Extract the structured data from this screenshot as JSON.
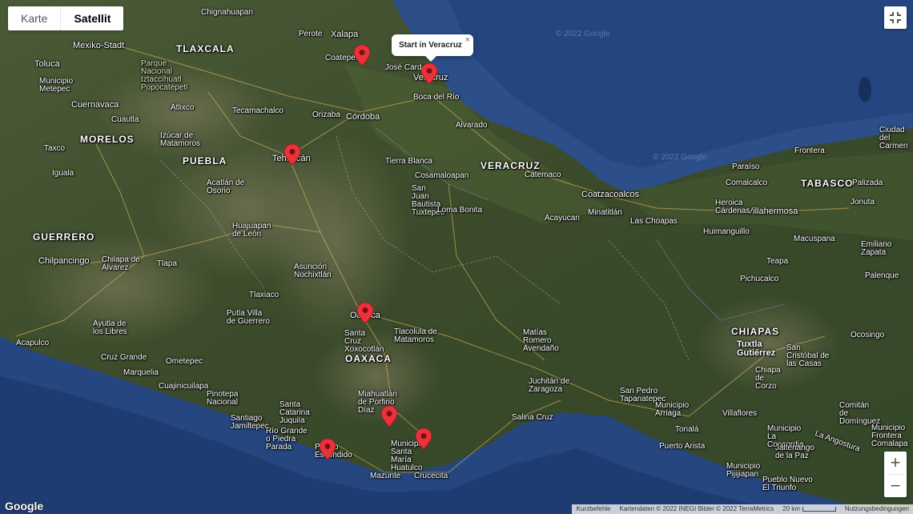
{
  "map_type": {
    "map_label": "Karte",
    "satellite_label": "Satellit",
    "active": "Satellit"
  },
  "info_window": {
    "title": "Start in Veracruz",
    "close_glyph": "×"
  },
  "controls": {
    "zoom_in": "+",
    "zoom_out": "−"
  },
  "logo": "Google",
  "footer": {
    "shortcuts": "Kurzbefehle",
    "map_data": "Kartendaten © 2022 INEGI Bilder © 2022 TerraMetrics",
    "scale": "20 km",
    "terms": "Nutzungsbedingungen"
  },
  "water_watermarks": [
    "© 2022 Google",
    "© 2022 Google"
  ],
  "regions": [
    {
      "name": "TLAXCALA"
    },
    {
      "name": "PUEBLA"
    },
    {
      "name": "MORELOS"
    },
    {
      "name": "GUERRERO"
    },
    {
      "name": "VERACRUZ"
    },
    {
      "name": "TABASCO"
    },
    {
      "name": "OAXACA"
    },
    {
      "name": "CHIAPAS"
    }
  ],
  "cities": [
    {
      "name": "Mexiko-Stadt"
    },
    {
      "name": "Toluca"
    },
    {
      "name": "Xalapa"
    },
    {
      "name": "Coatepec"
    },
    {
      "name": "José Cardel"
    },
    {
      "name": "Veracruz"
    },
    {
      "name": "Boca del Río"
    },
    {
      "name": "Córdoba"
    },
    {
      "name": "Orizaba"
    },
    {
      "name": "Alvarado"
    },
    {
      "name": "Tehuacán"
    },
    {
      "name": "Cuernavaca"
    },
    {
      "name": "Cuautla"
    },
    {
      "name": "Taxco"
    },
    {
      "name": "Iguala"
    },
    {
      "name": "Atlixco"
    },
    {
      "name": "Tecamachalco"
    },
    {
      "name": "Izúcar de Matamoros"
    },
    {
      "name": "Acatlán de Osorio"
    },
    {
      "name": "Huajuapan de León"
    },
    {
      "name": "Asunción Nochixtlán"
    },
    {
      "name": "Tlaxiaco"
    },
    {
      "name": "Chilpancingo"
    },
    {
      "name": "Chilapa de Álvarez"
    },
    {
      "name": "Tlapa"
    },
    {
      "name": "Tierra Blanca"
    },
    {
      "name": "Cosamaloapan"
    },
    {
      "name": "San Juan Bautista Tuxtepec"
    },
    {
      "name": "Loma Bonita"
    },
    {
      "name": "Catemaco"
    },
    {
      "name": "Coatzacoalcos"
    },
    {
      "name": "Minatitlán"
    },
    {
      "name": "Las Choapas"
    },
    {
      "name": "Acayucan"
    },
    {
      "name": "Villahermosa"
    },
    {
      "name": "Comalcalco"
    },
    {
      "name": "Paraíso"
    },
    {
      "name": "Frontera"
    },
    {
      "name": "Ciudad del Carmen"
    },
    {
      "name": "Palizada"
    },
    {
      "name": "Jonuta"
    },
    {
      "name": "Heroica Cárdenas"
    },
    {
      "name": "Huimanguillo"
    },
    {
      "name": "Macuspana"
    },
    {
      "name": "Emiliano Zapata"
    },
    {
      "name": "Teapa"
    },
    {
      "name": "Pichucalco"
    },
    {
      "name": "Palenque"
    },
    {
      "name": "Oaxaca"
    },
    {
      "name": "Santa Cruz Xoxocotlán"
    },
    {
      "name": "Tlacolula de Matamoros"
    },
    {
      "name": "Matías Romero Avendaño"
    },
    {
      "name": "Juchitán de Zaragoza"
    },
    {
      "name": "Salina Cruz"
    },
    {
      "name": "San Pedro Tapanatepec"
    },
    {
      "name": "Miahuatlán de Porfirio Díaz"
    },
    {
      "name": "Municipio Santa María Huatulco"
    },
    {
      "name": "Puerto Escondido"
    },
    {
      "name": "Mazunte"
    },
    {
      "name": "Crucecita"
    },
    {
      "name": "Santa Catarina Juquila"
    },
    {
      "name": "Río Grande o Piedra Parada"
    },
    {
      "name": "Santiago Jamiltepec"
    },
    {
      "name": "Pinotepa Nacional"
    },
    {
      "name": "Cuajinicuilapa"
    },
    {
      "name": "Marquelia"
    },
    {
      "name": "Ometepec"
    },
    {
      "name": "Cruz Grande"
    },
    {
      "name": "Ayutla de los Libres"
    },
    {
      "name": "Acapulco"
    },
    {
      "name": "Putla Villa de Guerrero"
    },
    {
      "name": "Tuxtla Gutiérrez"
    },
    {
      "name": "San Cristóbal de las Casas"
    },
    {
      "name": "Chiapa de Corzo"
    },
    {
      "name": "Comitán de Domínguez"
    },
    {
      "name": "Ocosingo"
    },
    {
      "name": "Villaflores"
    },
    {
      "name": "Tonalá"
    },
    {
      "name": "Municipio Arriaga"
    },
    {
      "name": "Puerto Arista"
    },
    {
      "name": "Municipio Pijijiapan"
    },
    {
      "name": "Pueblo Nuevo El Triunfo"
    },
    {
      "name": "Municipio La Concordia"
    },
    {
      "name": "Jaltenango de la Paz"
    },
    {
      "name": "Municipio Frontera Comalapa"
    },
    {
      "name": "La Angostura"
    },
    {
      "name": "Parque Nacional Iztaccíhuatl Popocatépetl"
    },
    {
      "name": "Municipio Metepec"
    },
    {
      "name": "Perote"
    },
    {
      "name": "Chignahuapan"
    }
  ],
  "markers": [
    {
      "name": "Veracruz"
    },
    {
      "name": "Xalapa"
    },
    {
      "name": "Tehuacán"
    },
    {
      "name": "Oaxaca"
    },
    {
      "name": "Miahuatlán"
    },
    {
      "name": "Huatulco"
    },
    {
      "name": "Puerto Escondido"
    }
  ],
  "colors": {
    "marker": "#e8333d",
    "ocean": "#1b3a6e",
    "land": "#3c4a2c"
  }
}
